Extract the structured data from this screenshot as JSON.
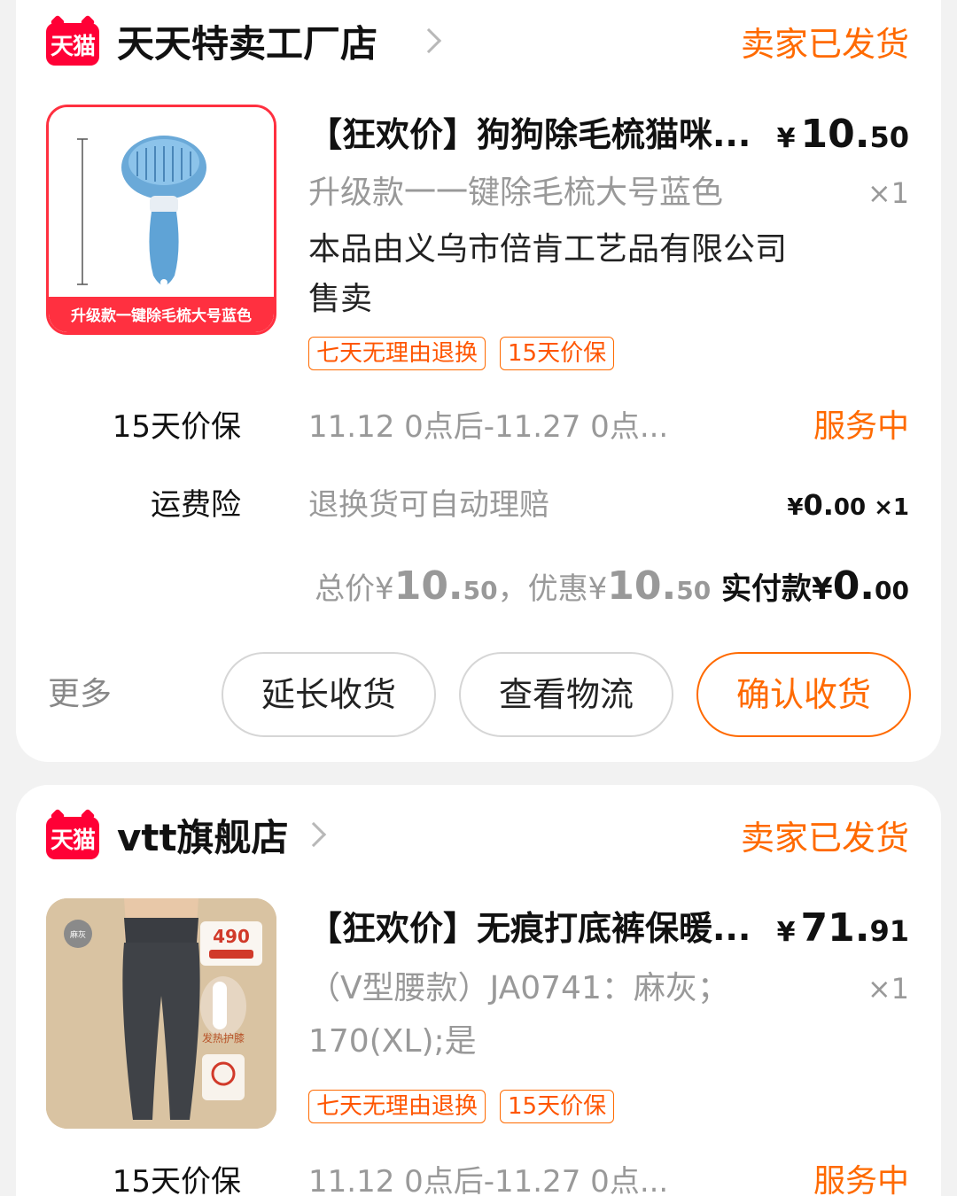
{
  "orders": [
    {
      "shop_logo": "天猫",
      "shop_name": "天天特卖工厂店",
      "status": "卖家已发货",
      "product": {
        "image_caption": "升级款一键除毛梳大号蓝色",
        "title": "【狂欢价】狗狗除毛梳猫咪...",
        "price_currency": "¥",
        "price_int": "10.",
        "price_dec": "50",
        "sku": "升级款一一键除毛梳大号蓝色",
        "quantity": "×1",
        "seller_note": "本品由义乌市倍肯工艺品有限公司售卖",
        "tags": [
          "七天无理由退换",
          "15天价保"
        ]
      },
      "services": [
        {
          "label": "15天价保",
          "desc": "11.12 0点后-11.27 0点...",
          "status": "服务中"
        },
        {
          "label": "运费险",
          "desc": "退换货可自动理赔",
          "price_prefix": "¥",
          "price_int": "0.",
          "price_dec": "00",
          "qty": " ×1"
        }
      ],
      "totals": {
        "total_label": "总价¥",
        "total_int": "10.",
        "total_dec": "50",
        "discount_label": "，优惠¥",
        "discount_int": "10.",
        "discount_dec": "50",
        "paid_label": " 实付款¥",
        "paid_int": "0.",
        "paid_dec": "00"
      },
      "actions": {
        "more": "更多",
        "extend": "延长收货",
        "logistics": "查看物流",
        "confirm": "确认收货"
      }
    },
    {
      "shop_logo": "天猫",
      "shop_name": "vtt旗舰店",
      "status": "卖家已发货",
      "product": {
        "image_badge": "麻灰",
        "image_price": "490",
        "image_feature": "发热护膝",
        "title": "【狂欢价】无痕打底裤保暖...",
        "price_currency": "¥",
        "price_int": "71.",
        "price_dec": "91",
        "sku": "（V型腰款）JA0741：麻灰；170(XL);是",
        "quantity": "×1",
        "tags": [
          "七天无理由退换",
          "15天价保"
        ]
      },
      "services": [
        {
          "label": "15天价保",
          "desc": "11.12 0点后-11.27 0点...",
          "status": "服务中"
        }
      ]
    }
  ],
  "colors": {
    "accent": "#ff6a00",
    "tmall_red": "#ff0036",
    "muted": "#999999",
    "card_bg": "#ffffff",
    "page_bg": "#f2f2f2"
  },
  "icons": [
    "tmall-logo-icon",
    "chevron-right-icon"
  ]
}
